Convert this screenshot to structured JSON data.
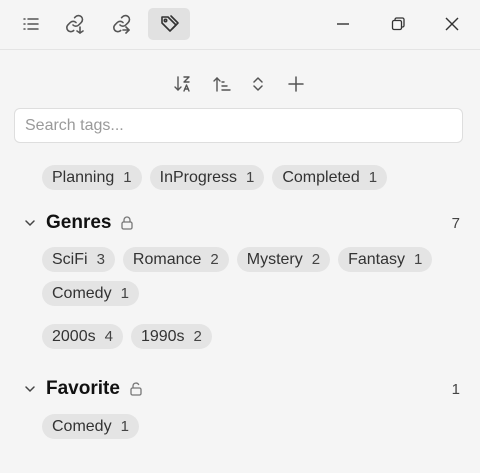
{
  "toolbar_top": {
    "icons": [
      "list-icon",
      "backlink-icon",
      "outgoing-link-icon",
      "tag-icon"
    ],
    "window_icons": [
      "minimize-icon",
      "restore-icon",
      "close-icon"
    ]
  },
  "sort_toolbar": {
    "icons": [
      "sort-az-icon",
      "sort-ascending-icon",
      "expand-collapse-icon",
      "plus-icon"
    ]
  },
  "search": {
    "placeholder": "Search tags..."
  },
  "status_tags": [
    {
      "label": "Planning",
      "count": "1"
    },
    {
      "label": "InProgress",
      "count": "1"
    },
    {
      "label": "Completed",
      "count": "1"
    }
  ],
  "genres": {
    "title": "Genres",
    "count": "7",
    "row1": [
      {
        "label": "SciFi",
        "count": "3"
      },
      {
        "label": "Romance",
        "count": "2"
      },
      {
        "label": "Mystery",
        "count": "2"
      },
      {
        "label": "Fantasy",
        "count": "1"
      }
    ],
    "row2": [
      {
        "label": "Comedy",
        "count": "1"
      }
    ]
  },
  "decades": [
    {
      "label": "2000s",
      "count": "4"
    },
    {
      "label": "1990s",
      "count": "2"
    }
  ],
  "favorite": {
    "title": "Favorite",
    "count": "1",
    "tags": [
      {
        "label": "Comedy",
        "count": "1"
      }
    ]
  }
}
